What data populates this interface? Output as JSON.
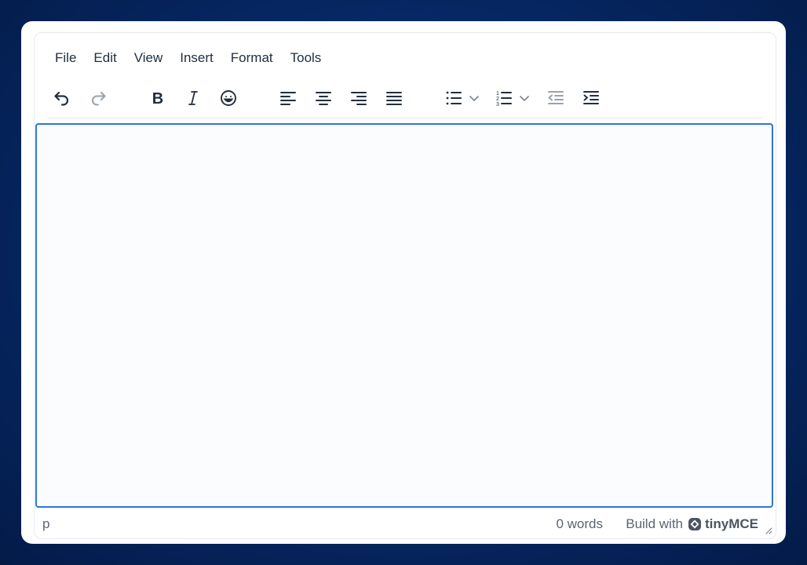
{
  "menubar": {
    "items": [
      "File",
      "Edit",
      "View",
      "Insert",
      "Format",
      "Tools"
    ]
  },
  "toolbar": {
    "buttons": [
      {
        "name": "undo-icon",
        "enabled": true
      },
      {
        "name": "redo-icon",
        "enabled": false
      },
      {
        "name": "bold-icon",
        "enabled": true
      },
      {
        "name": "italic-icon",
        "enabled": true
      },
      {
        "name": "emoji-icon",
        "enabled": true
      },
      {
        "name": "align-left-icon",
        "enabled": true
      },
      {
        "name": "align-center-icon",
        "enabled": true
      },
      {
        "name": "align-right-icon",
        "enabled": true
      },
      {
        "name": "align-justify-icon",
        "enabled": true
      },
      {
        "name": "bullet-list-icon",
        "enabled": true
      },
      {
        "name": "numbered-list-icon",
        "enabled": true
      },
      {
        "name": "outdent-icon",
        "enabled": false
      },
      {
        "name": "indent-icon",
        "enabled": true
      }
    ]
  },
  "statusbar": {
    "path": "p",
    "word_count": "0 words",
    "branding_prefix": "Build with",
    "branding_name": "tinyMCE"
  },
  "colors": {
    "focus_border": "#2d77d0",
    "icon": "#222f3e",
    "icon_disabled": "#9aa2ab"
  }
}
